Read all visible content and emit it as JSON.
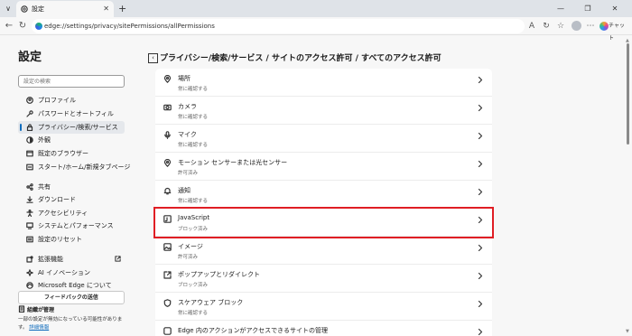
{
  "browser": {
    "tab_title": "設定",
    "url": "edge://settings/privacy/sitePermissions/allPermissions",
    "chat_label": "チャット"
  },
  "sidebar": {
    "title": "設定",
    "search_placeholder": "設定の検索",
    "items": [
      {
        "label": "プロファイル",
        "icon": "profile-icon"
      },
      {
        "label": "パスワードとオートフィル",
        "icon": "key-icon"
      },
      {
        "label": "プライバシー/検索/サービス",
        "icon": "lock-icon",
        "active": true
      },
      {
        "label": "外観",
        "icon": "appearance-icon"
      },
      {
        "label": "既定のブラウザー",
        "icon": "browser-icon"
      },
      {
        "label": "スタート/ホーム/新規タブページ",
        "icon": "home-icon"
      },
      {
        "label": "共有",
        "icon": "share-icon"
      },
      {
        "label": "ダウンロード",
        "icon": "download-icon"
      },
      {
        "label": "アクセシビリティ",
        "icon": "accessibility-icon"
      },
      {
        "label": "システムとパフォーマンス",
        "icon": "system-icon"
      },
      {
        "label": "設定のリセット",
        "icon": "reset-icon"
      },
      {
        "label": "拡張機能",
        "icon": "extensions-icon"
      },
      {
        "label": "AI イノベーション",
        "icon": "ai-icon"
      },
      {
        "label": "Microsoft Edge について",
        "icon": "edge-icon"
      }
    ],
    "feedback_label": "フィードバックの送信",
    "org_managed_label": "組織が管理",
    "org_desc": "一部の設定が無効になっている可能性があります。",
    "org_link": "詳細情報"
  },
  "main": {
    "breadcrumb": "プライバシー/検索/サービス  /  サイトのアクセス許可  /  すべてのアクセス許可",
    "permissions": [
      {
        "title": "場所",
        "status": "常に確認する",
        "icon": "location-icon"
      },
      {
        "title": "カメラ",
        "status": "常に確認する",
        "icon": "camera-icon"
      },
      {
        "title": "マイク",
        "status": "常に確認する",
        "icon": "microphone-icon"
      },
      {
        "title": "モーション センサーまたは光センサー",
        "status": "許可済み",
        "icon": "motion-sensor-icon"
      },
      {
        "title": "通知",
        "status": "常に確認する",
        "icon": "bell-icon"
      },
      {
        "title": "JavaScript",
        "status": "ブロック済み",
        "icon": "javascript-icon",
        "highlighted": true
      },
      {
        "title": "イメージ",
        "status": "許可済み",
        "icon": "image-icon"
      },
      {
        "title": "ポップアップとリダイレクト",
        "status": "ブロック済み",
        "icon": "popup-icon"
      },
      {
        "title": "スケアウェア ブロック",
        "status": "常に確認する",
        "icon": "shield-icon"
      },
      {
        "title": "Edge 内のアクションがアクセスできるサイトの管理",
        "status": "",
        "icon": "edge-actions-icon"
      }
    ]
  },
  "colors": {
    "accent": "#0f6cbd",
    "highlight": "#e01e24"
  }
}
